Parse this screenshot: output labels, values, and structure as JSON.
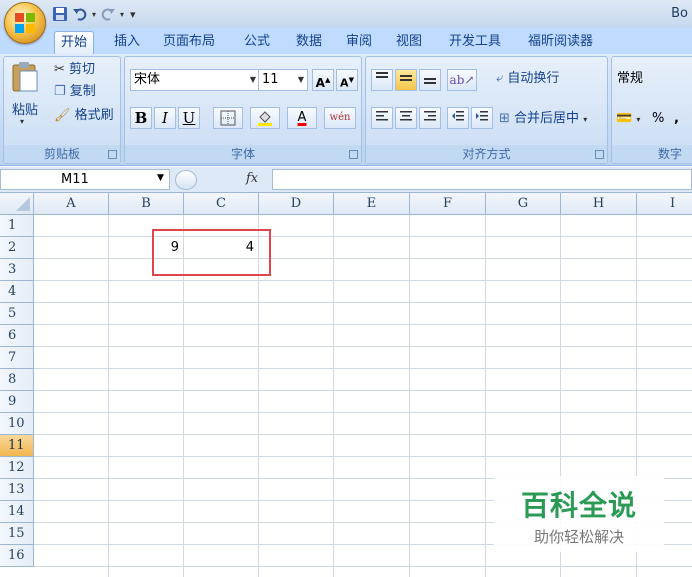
{
  "window": {
    "title": "Bo"
  },
  "tabs": [
    "开始",
    "插入",
    "页面布局",
    "公式",
    "数据",
    "审阅",
    "视图",
    "开发工具",
    "福昕阅读器"
  ],
  "clipboard": {
    "paste": "粘贴",
    "cut": "剪切",
    "copy": "复制",
    "format_painter": "格式刷",
    "label": "剪贴板"
  },
  "font": {
    "name": "宋体",
    "size": "11",
    "bold": "B",
    "italic": "I",
    "underline": "U",
    "label": "字体"
  },
  "alignment": {
    "wrap_text": "自动换行",
    "merge_center": "合并后居中",
    "label": "对齐方式"
  },
  "number": {
    "format": "常规",
    "percent": "%",
    "label": "数字"
  },
  "formula_bar": {
    "name_box": "M11",
    "fx": "fx",
    "value": ""
  },
  "sheet": {
    "columns": [
      "A",
      "B",
      "C",
      "D",
      "E",
      "F",
      "G",
      "H",
      "I"
    ],
    "rows": [
      "1",
      "2",
      "3",
      "4",
      "5",
      "6",
      "7",
      "8",
      "9",
      "10",
      "11",
      "12",
      "13",
      "14",
      "15",
      "16"
    ],
    "selected_row": "11",
    "cells": {
      "B2": "9",
      "C2": "4"
    }
  },
  "watermark": {
    "title": "百科全说",
    "subtitle": "助你轻松解决"
  },
  "colors": {
    "highlight_box": "#e0454d",
    "watermark_green": "#2b9a55"
  }
}
